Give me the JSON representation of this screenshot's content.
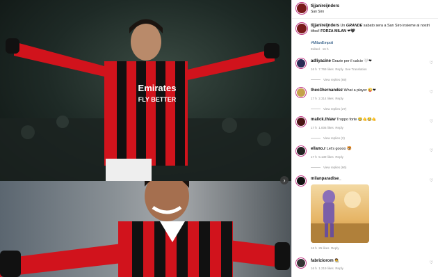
{
  "post": {
    "author": "tijjanireijnders",
    "location": "San Siro",
    "caption_user": "tijjanireijnders",
    "caption_pre": " Un ",
    "caption_bold": "GRANDE",
    "caption_mid": " sabato sera a San Siro insieme ai nostri tifosi! ",
    "caption_bold2": "FORZA MILAN",
    "caption_emojis": "❤🖤",
    "hashtag": "#MilanEmpoli",
    "edited": "Edited · 16 h"
  },
  "media": {
    "shirt_sponsor_top": "Emirates",
    "shirt_sponsor_top_2": "FLY BETTER",
    "next_glyph": "›"
  },
  "comments": [
    {
      "user": "adliyacine",
      "text": "Grazie per il calcio 🤍❤",
      "time": "16 h",
      "likes": "7.769 likes",
      "reply": "Reply",
      "extra": "See Translation",
      "view": "View replies (69)"
    },
    {
      "user": "theo3hernandez",
      "text": "What a player 😜❤",
      "time": "17 h",
      "likes": "2.314 likes",
      "reply": "Reply",
      "extra": "",
      "view": "View replies (27)"
    },
    {
      "user": "malick.thiaw",
      "text": "Troppo forte 😂🤙😂🤙",
      "time": "17 h",
      "likes": "1.006 likes",
      "reply": "Reply",
      "extra": "",
      "view": "View replies (2)"
    },
    {
      "user": "ellano.r",
      "text": "Let's goooo 🐯",
      "time": "17 h",
      "likes": "5.139 likes",
      "reply": "Reply",
      "extra": "",
      "view": "View replies (66)"
    },
    {
      "user": "milanparadise_",
      "text": "",
      "time": "16 h",
      "likes": "25 likes",
      "reply": "Reply",
      "extra": "",
      "view": ""
    },
    {
      "user": "fabriziorom",
      "text": "🧑‍🎨",
      "time": "16 h",
      "likes": "1.219 likes",
      "reply": "Reply",
      "extra": "",
      "view": ""
    }
  ],
  "icons": {
    "heart": "♡"
  }
}
